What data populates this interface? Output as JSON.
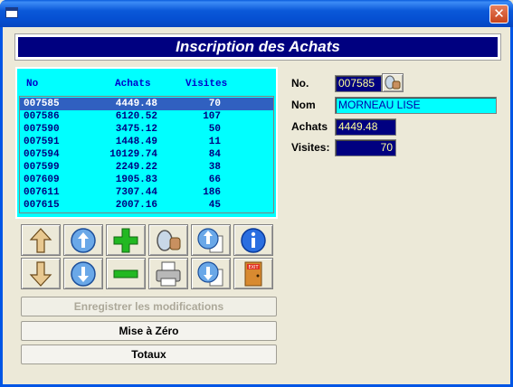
{
  "window": {
    "close_label": "✕"
  },
  "header": {
    "title": "Inscription des Achats"
  },
  "list": {
    "columns": {
      "no": "No",
      "achats": "Achats",
      "visites": "Visites"
    },
    "rows": [
      {
        "no": "007585",
        "achats": "4449.48",
        "visites": "70"
      },
      {
        "no": "007586",
        "achats": "6120.52",
        "visites": "107"
      },
      {
        "no": "007590",
        "achats": "3475.12",
        "visites": "50"
      },
      {
        "no": "007591",
        "achats": "1448.49",
        "visites": "11"
      },
      {
        "no": "007594",
        "achats": "10129.74",
        "visites": "84"
      },
      {
        "no": "007599",
        "achats": "2249.22",
        "visites": "38"
      },
      {
        "no": "007609",
        "achats": "1905.83",
        "visites": "66"
      },
      {
        "no": "007611",
        "achats": "7307.44",
        "visites": "186"
      },
      {
        "no": "007615",
        "achats": "2007.16",
        "visites": "45"
      }
    ],
    "selected_index": 0
  },
  "toolbar_icons": [
    "arrow-up-icon",
    "up-circle-icon",
    "add-icon",
    "search-icon",
    "up-doc-icon",
    "info-icon",
    "arrow-down-icon",
    "down-circle-icon",
    "remove-icon",
    "print-icon",
    "down-doc-icon",
    "exit-icon"
  ],
  "exit_text": "EXIT",
  "buttons": {
    "save": "Enregistrer les modifications",
    "reset": "Mise à Zéro",
    "totals": "Totaux"
  },
  "form": {
    "no_label": "No.",
    "no_value": "007585",
    "nom_label": "Nom",
    "nom_value": "MORNEAU LISE",
    "achats_label": "Achats",
    "achats_value": "4449.48",
    "visites_label": "Visites:",
    "visites_value": "70"
  },
  "colors": {
    "list_bg": "#00ffff",
    "header_bg": "#000080",
    "selection": "#3060c0"
  }
}
